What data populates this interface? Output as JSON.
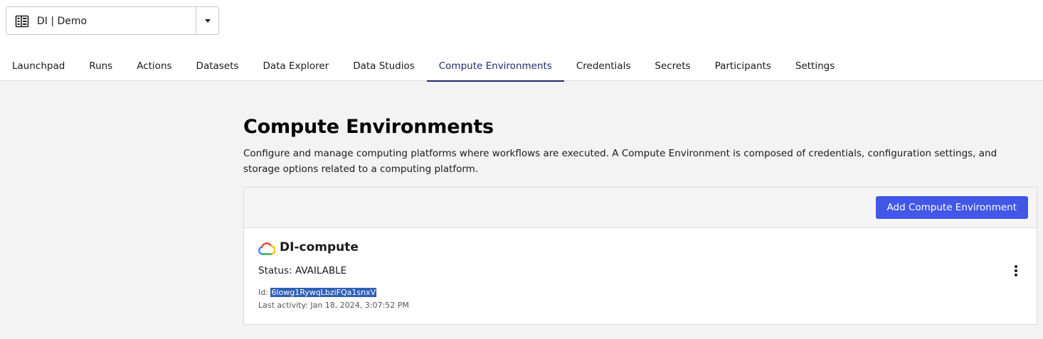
{
  "workspace": {
    "label": "DI | Demo",
    "icon": "workspace-building-icon"
  },
  "tabs": [
    {
      "label": "Launchpad",
      "active": false
    },
    {
      "label": "Runs",
      "active": false
    },
    {
      "label": "Actions",
      "active": false
    },
    {
      "label": "Datasets",
      "active": false
    },
    {
      "label": "Data Explorer",
      "active": false
    },
    {
      "label": "Data Studios",
      "active": false
    },
    {
      "label": "Compute Environments",
      "active": true
    },
    {
      "label": "Credentials",
      "active": false
    },
    {
      "label": "Secrets",
      "active": false
    },
    {
      "label": "Participants",
      "active": false
    },
    {
      "label": "Settings",
      "active": false
    }
  ],
  "page": {
    "title": "Compute Environments",
    "description": "Configure and manage computing platforms where workflows are executed. A Compute Environment is composed of credentials, configuration settings, and storage options related to a computing platform."
  },
  "panel": {
    "add_button": "Add Compute Environment"
  },
  "compute_env": {
    "name": "DI-compute",
    "provider_icon": "google-cloud-icon",
    "status": "Status: AVAILABLE",
    "id_label": "Id:",
    "id_value": "6lowg1RywqLbziFQa1snxV",
    "last_activity": "Last activity: Jan 18, 2024, 3:07:52 PM"
  },
  "colors": {
    "accent": "#4256e7",
    "active_tab": "#1c2b6d",
    "selection": "#2f5fb5",
    "background": "#f3f3f4"
  }
}
